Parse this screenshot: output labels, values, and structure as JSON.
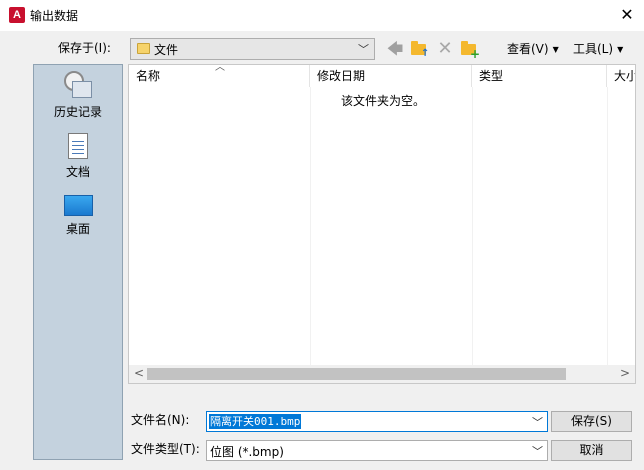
{
  "window": {
    "title": "输出数据",
    "app_logo": "A"
  },
  "toolbar": {
    "save_in_label": "保存于(I):",
    "current_folder": "文件",
    "views_label": "查看(V)",
    "tools_label": "工具(L)"
  },
  "places": [
    {
      "label": "历史记录",
      "icon": "history-icon"
    },
    {
      "label": "文档",
      "icon": "document-icon"
    },
    {
      "label": "桌面",
      "icon": "desktop-icon"
    }
  ],
  "file_list": {
    "columns": [
      "名称",
      "修改日期",
      "类型",
      "大小"
    ],
    "empty_message": "该文件夹为空。"
  },
  "form": {
    "file_name_label": "文件名(N):",
    "file_name_value": "隔离开关001.bmp",
    "file_type_label": "文件类型(T):",
    "file_type_value": "位图 (*.bmp)",
    "save_button": "保存(S)",
    "cancel_button": "取消"
  },
  "colors": {
    "accent": "#0078d7",
    "places_background": "#c4d2de",
    "app_logo": "#c8102e"
  }
}
